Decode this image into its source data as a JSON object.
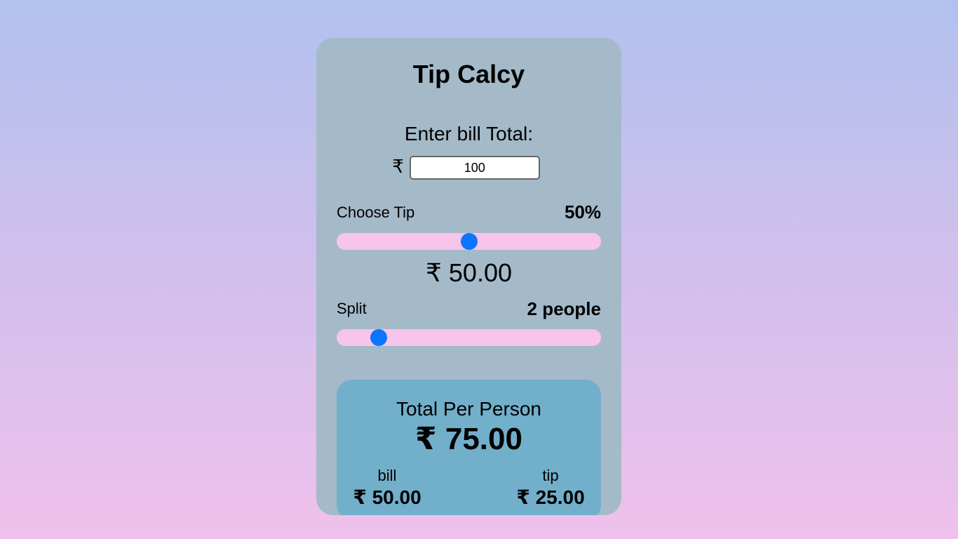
{
  "app": {
    "title": "Tip Calcy"
  },
  "bill": {
    "label": "Enter bill Total:",
    "currency_symbol": "₹",
    "value": "100"
  },
  "tip": {
    "label": "Choose Tip",
    "value_text": "50%",
    "slider_fraction": 0.5,
    "amount_text": "₹ 50.00"
  },
  "split": {
    "label": "Split",
    "value_text": "2 people",
    "slider_fraction": 0.135
  },
  "result": {
    "label": "Total Per Person",
    "total_text": "₹ 75.00",
    "bill_label": "bill",
    "bill_value": "₹ 50.00",
    "tip_label": "tip",
    "tip_value": "₹ 25.00"
  },
  "colors": {
    "card": "#a4bac9",
    "result_box": "#72afcb",
    "slider_track": "#f7c4ea",
    "slider_thumb": "#0b75ff"
  }
}
